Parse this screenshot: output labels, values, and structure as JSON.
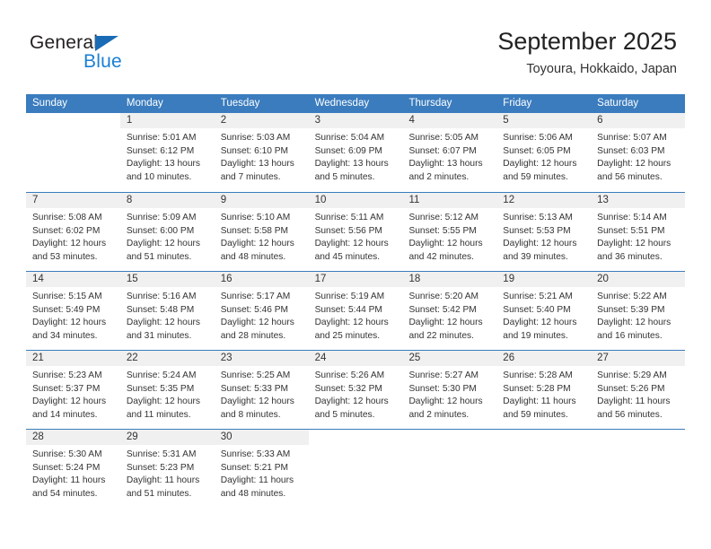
{
  "brand": {
    "name_top": "General",
    "name_bottom": "Blue",
    "accent_color": "#1a7fd4",
    "triangle_color": "#1a6bb5"
  },
  "header": {
    "title": "September 2025",
    "subtitle": "Toyoura, Hokkaido, Japan"
  },
  "theme": {
    "header_bar_color": "#3a7cbe",
    "daynum_strip_color": "#f0f0f0",
    "text_color": "#333333"
  },
  "weekdays": [
    "Sunday",
    "Monday",
    "Tuesday",
    "Wednesday",
    "Thursday",
    "Friday",
    "Saturday"
  ],
  "weeks": [
    [
      {
        "day": "",
        "sunrise": "",
        "sunset": "",
        "daylight": ""
      },
      {
        "day": "1",
        "sunrise": "Sunrise: 5:01 AM",
        "sunset": "Sunset: 6:12 PM",
        "daylight": "Daylight: 13 hours and 10 minutes."
      },
      {
        "day": "2",
        "sunrise": "Sunrise: 5:03 AM",
        "sunset": "Sunset: 6:10 PM",
        "daylight": "Daylight: 13 hours and 7 minutes."
      },
      {
        "day": "3",
        "sunrise": "Sunrise: 5:04 AM",
        "sunset": "Sunset: 6:09 PM",
        "daylight": "Daylight: 13 hours and 5 minutes."
      },
      {
        "day": "4",
        "sunrise": "Sunrise: 5:05 AM",
        "sunset": "Sunset: 6:07 PM",
        "daylight": "Daylight: 13 hours and 2 minutes."
      },
      {
        "day": "5",
        "sunrise": "Sunrise: 5:06 AM",
        "sunset": "Sunset: 6:05 PM",
        "daylight": "Daylight: 12 hours and 59 minutes."
      },
      {
        "day": "6",
        "sunrise": "Sunrise: 5:07 AM",
        "sunset": "Sunset: 6:03 PM",
        "daylight": "Daylight: 12 hours and 56 minutes."
      }
    ],
    [
      {
        "day": "7",
        "sunrise": "Sunrise: 5:08 AM",
        "sunset": "Sunset: 6:02 PM",
        "daylight": "Daylight: 12 hours and 53 minutes."
      },
      {
        "day": "8",
        "sunrise": "Sunrise: 5:09 AM",
        "sunset": "Sunset: 6:00 PM",
        "daylight": "Daylight: 12 hours and 51 minutes."
      },
      {
        "day": "9",
        "sunrise": "Sunrise: 5:10 AM",
        "sunset": "Sunset: 5:58 PM",
        "daylight": "Daylight: 12 hours and 48 minutes."
      },
      {
        "day": "10",
        "sunrise": "Sunrise: 5:11 AM",
        "sunset": "Sunset: 5:56 PM",
        "daylight": "Daylight: 12 hours and 45 minutes."
      },
      {
        "day": "11",
        "sunrise": "Sunrise: 5:12 AM",
        "sunset": "Sunset: 5:55 PM",
        "daylight": "Daylight: 12 hours and 42 minutes."
      },
      {
        "day": "12",
        "sunrise": "Sunrise: 5:13 AM",
        "sunset": "Sunset: 5:53 PM",
        "daylight": "Daylight: 12 hours and 39 minutes."
      },
      {
        "day": "13",
        "sunrise": "Sunrise: 5:14 AM",
        "sunset": "Sunset: 5:51 PM",
        "daylight": "Daylight: 12 hours and 36 minutes."
      }
    ],
    [
      {
        "day": "14",
        "sunrise": "Sunrise: 5:15 AM",
        "sunset": "Sunset: 5:49 PM",
        "daylight": "Daylight: 12 hours and 34 minutes."
      },
      {
        "day": "15",
        "sunrise": "Sunrise: 5:16 AM",
        "sunset": "Sunset: 5:48 PM",
        "daylight": "Daylight: 12 hours and 31 minutes."
      },
      {
        "day": "16",
        "sunrise": "Sunrise: 5:17 AM",
        "sunset": "Sunset: 5:46 PM",
        "daylight": "Daylight: 12 hours and 28 minutes."
      },
      {
        "day": "17",
        "sunrise": "Sunrise: 5:19 AM",
        "sunset": "Sunset: 5:44 PM",
        "daylight": "Daylight: 12 hours and 25 minutes."
      },
      {
        "day": "18",
        "sunrise": "Sunrise: 5:20 AM",
        "sunset": "Sunset: 5:42 PM",
        "daylight": "Daylight: 12 hours and 22 minutes."
      },
      {
        "day": "19",
        "sunrise": "Sunrise: 5:21 AM",
        "sunset": "Sunset: 5:40 PM",
        "daylight": "Daylight: 12 hours and 19 minutes."
      },
      {
        "day": "20",
        "sunrise": "Sunrise: 5:22 AM",
        "sunset": "Sunset: 5:39 PM",
        "daylight": "Daylight: 12 hours and 16 minutes."
      }
    ],
    [
      {
        "day": "21",
        "sunrise": "Sunrise: 5:23 AM",
        "sunset": "Sunset: 5:37 PM",
        "daylight": "Daylight: 12 hours and 14 minutes."
      },
      {
        "day": "22",
        "sunrise": "Sunrise: 5:24 AM",
        "sunset": "Sunset: 5:35 PM",
        "daylight": "Daylight: 12 hours and 11 minutes."
      },
      {
        "day": "23",
        "sunrise": "Sunrise: 5:25 AM",
        "sunset": "Sunset: 5:33 PM",
        "daylight": "Daylight: 12 hours and 8 minutes."
      },
      {
        "day": "24",
        "sunrise": "Sunrise: 5:26 AM",
        "sunset": "Sunset: 5:32 PM",
        "daylight": "Daylight: 12 hours and 5 minutes."
      },
      {
        "day": "25",
        "sunrise": "Sunrise: 5:27 AM",
        "sunset": "Sunset: 5:30 PM",
        "daylight": "Daylight: 12 hours and 2 minutes."
      },
      {
        "day": "26",
        "sunrise": "Sunrise: 5:28 AM",
        "sunset": "Sunset: 5:28 PM",
        "daylight": "Daylight: 11 hours and 59 minutes."
      },
      {
        "day": "27",
        "sunrise": "Sunrise: 5:29 AM",
        "sunset": "Sunset: 5:26 PM",
        "daylight": "Daylight: 11 hours and 56 minutes."
      }
    ],
    [
      {
        "day": "28",
        "sunrise": "Sunrise: 5:30 AM",
        "sunset": "Sunset: 5:24 PM",
        "daylight": "Daylight: 11 hours and 54 minutes."
      },
      {
        "day": "29",
        "sunrise": "Sunrise: 5:31 AM",
        "sunset": "Sunset: 5:23 PM",
        "daylight": "Daylight: 11 hours and 51 minutes."
      },
      {
        "day": "30",
        "sunrise": "Sunrise: 5:33 AM",
        "sunset": "Sunset: 5:21 PM",
        "daylight": "Daylight: 11 hours and 48 minutes."
      },
      {
        "day": "",
        "sunrise": "",
        "sunset": "",
        "daylight": ""
      },
      {
        "day": "",
        "sunrise": "",
        "sunset": "",
        "daylight": ""
      },
      {
        "day": "",
        "sunrise": "",
        "sunset": "",
        "daylight": ""
      },
      {
        "day": "",
        "sunrise": "",
        "sunset": "",
        "daylight": ""
      }
    ]
  ]
}
